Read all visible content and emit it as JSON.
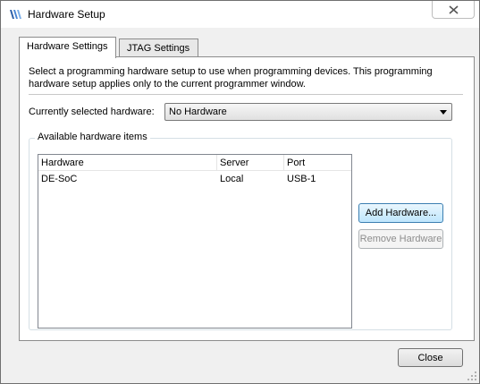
{
  "window": {
    "title": "Hardware Setup",
    "close_glyph": "✕",
    "icon": "hardware-setup-app-icon"
  },
  "tabs": [
    {
      "label": "Hardware Settings",
      "active": true
    },
    {
      "label": "JTAG Settings",
      "active": false
    }
  ],
  "settings": {
    "description": "Select a programming hardware setup to use when programming devices. This programming hardware setup applies only to the current programmer window.",
    "hardware_label": "Currently selected hardware:",
    "hardware_value": "No Hardware",
    "group_title": "Available hardware items",
    "columns": [
      "Hardware",
      "Server",
      "Port"
    ],
    "rows": [
      {
        "hardware": "DE-SoC",
        "server": "Local",
        "port": "USB-1"
      }
    ],
    "add_button": "Add Hardware...",
    "remove_button": "Remove Hardware"
  },
  "footer": {
    "close_button": "Close"
  }
}
